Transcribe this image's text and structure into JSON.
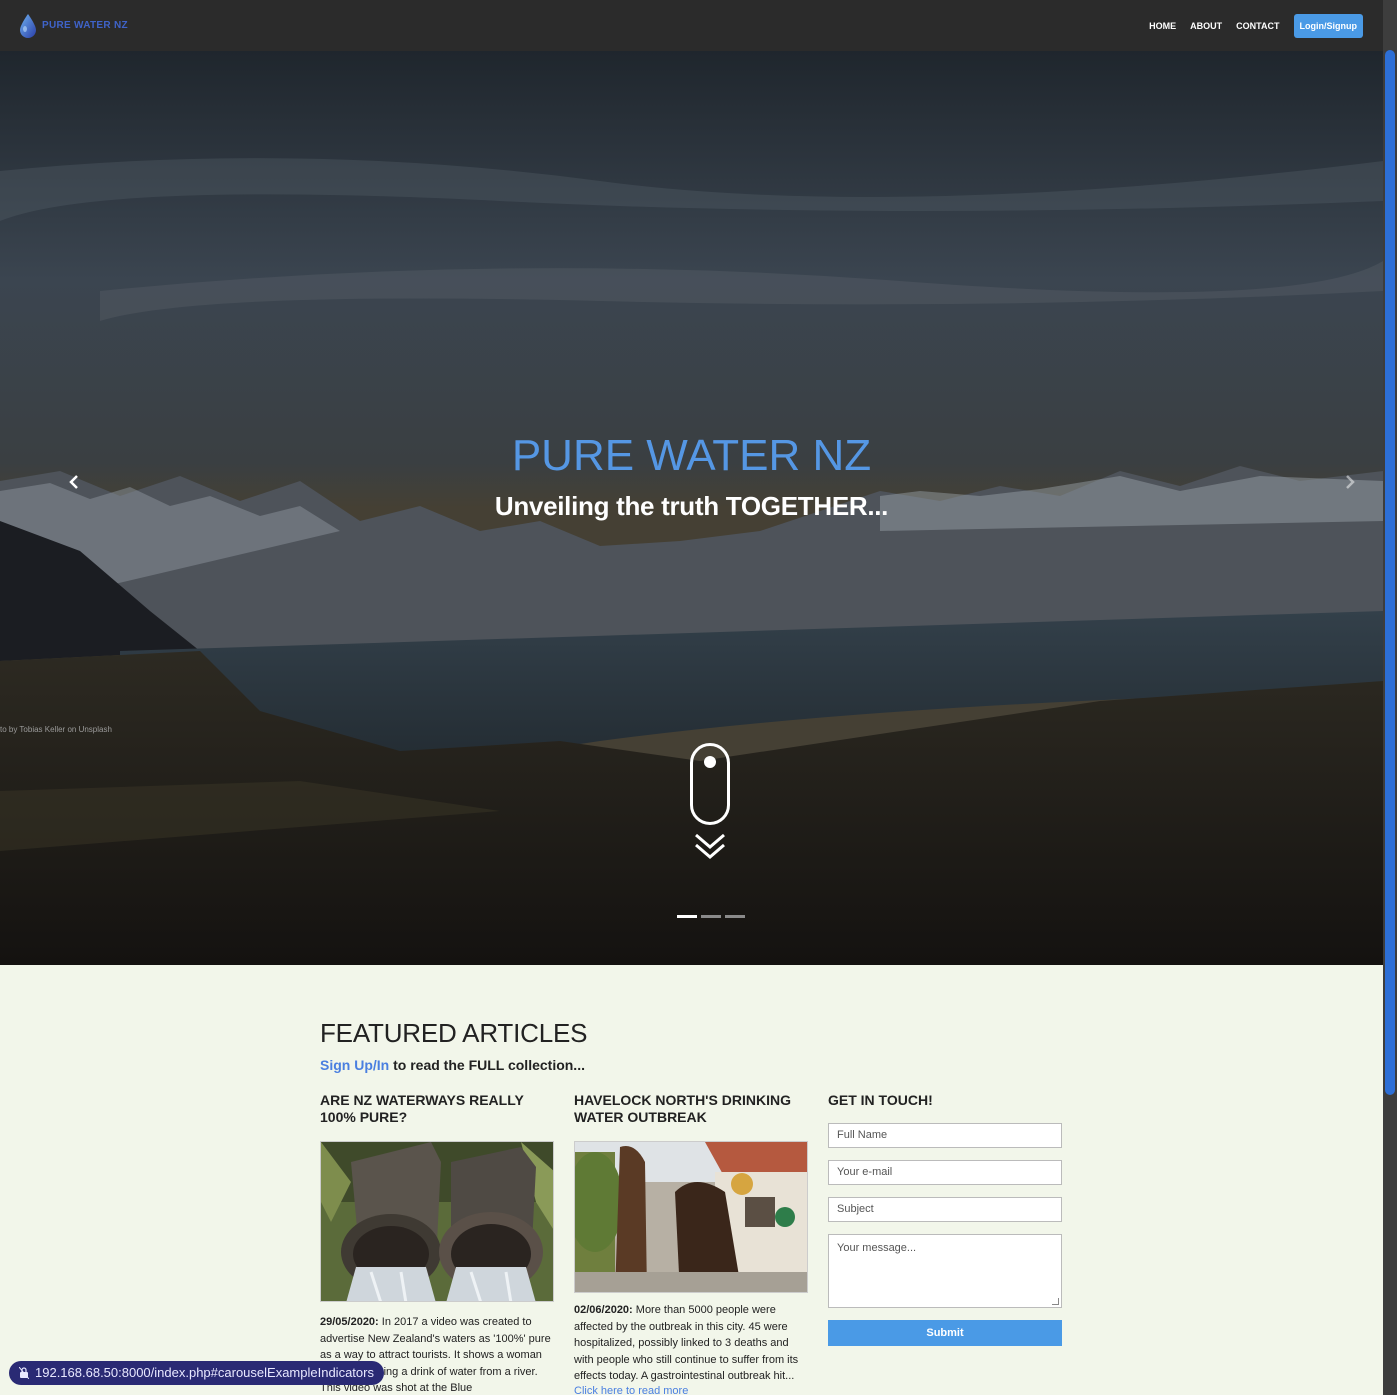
{
  "brand": {
    "name": "PURE WATER NZ",
    "logo_icon": "water-drop-icon"
  },
  "nav": {
    "links": [
      "HOME",
      "ABOUT",
      "CONTACT"
    ],
    "login_label": "Login/Signup"
  },
  "hero": {
    "title": "PURE WATER NZ",
    "subtitle": "Unveiling the truth TOGETHER...",
    "credit": "to by Tobias Keller on Unsplash",
    "slide_count": 3,
    "active_slide": 1,
    "prev_icon": "chevron-left-icon",
    "next_icon": "chevron-right-icon",
    "scroll_icon": "mouse-scroll-icon"
  },
  "featured": {
    "title": "FEATURED ARTICLES",
    "signup_link": "Sign Up/In",
    "signup_rest": " to read the FULL collection..."
  },
  "articles": [
    {
      "title": "ARE NZ WATERWAYS REALLY 100% PURE?",
      "date": "29/05/2020:",
      "text": " In 2017 a video was created to advertise New Zealand's waters as '100%' pure as a way to attract tourists. It shows a woman tramping, taking a drink of water from a river. This video was shot at the Blue"
    },
    {
      "title": "HAVELOCK NORTH'S DRINKING WATER OUTBREAK",
      "date": "02/06/2020:",
      "text": " More than 5000 people were affected by the outbreak in this city. 45 were hospitalized, possibly linked to 3 deaths and with people who still continue to suffer from its effects today. A gastrointestinal outbreak hit...",
      "read_more": "Click here to read more"
    }
  ],
  "contact": {
    "title": "GET IN TOUCH!",
    "name_placeholder": "Full Name",
    "email_placeholder": "Your e-mail",
    "subject_placeholder": "Subject",
    "message_placeholder": "Your message...",
    "submit_label": "Submit"
  },
  "status_bar": {
    "url": "192.168.68.50:8000/index.php#carouselExampleIndicators"
  },
  "colors": {
    "accent": "#4a9ae6",
    "title_blue": "#5597e4",
    "link": "#4a7fe0",
    "page_bg": "#f2f6ea"
  }
}
